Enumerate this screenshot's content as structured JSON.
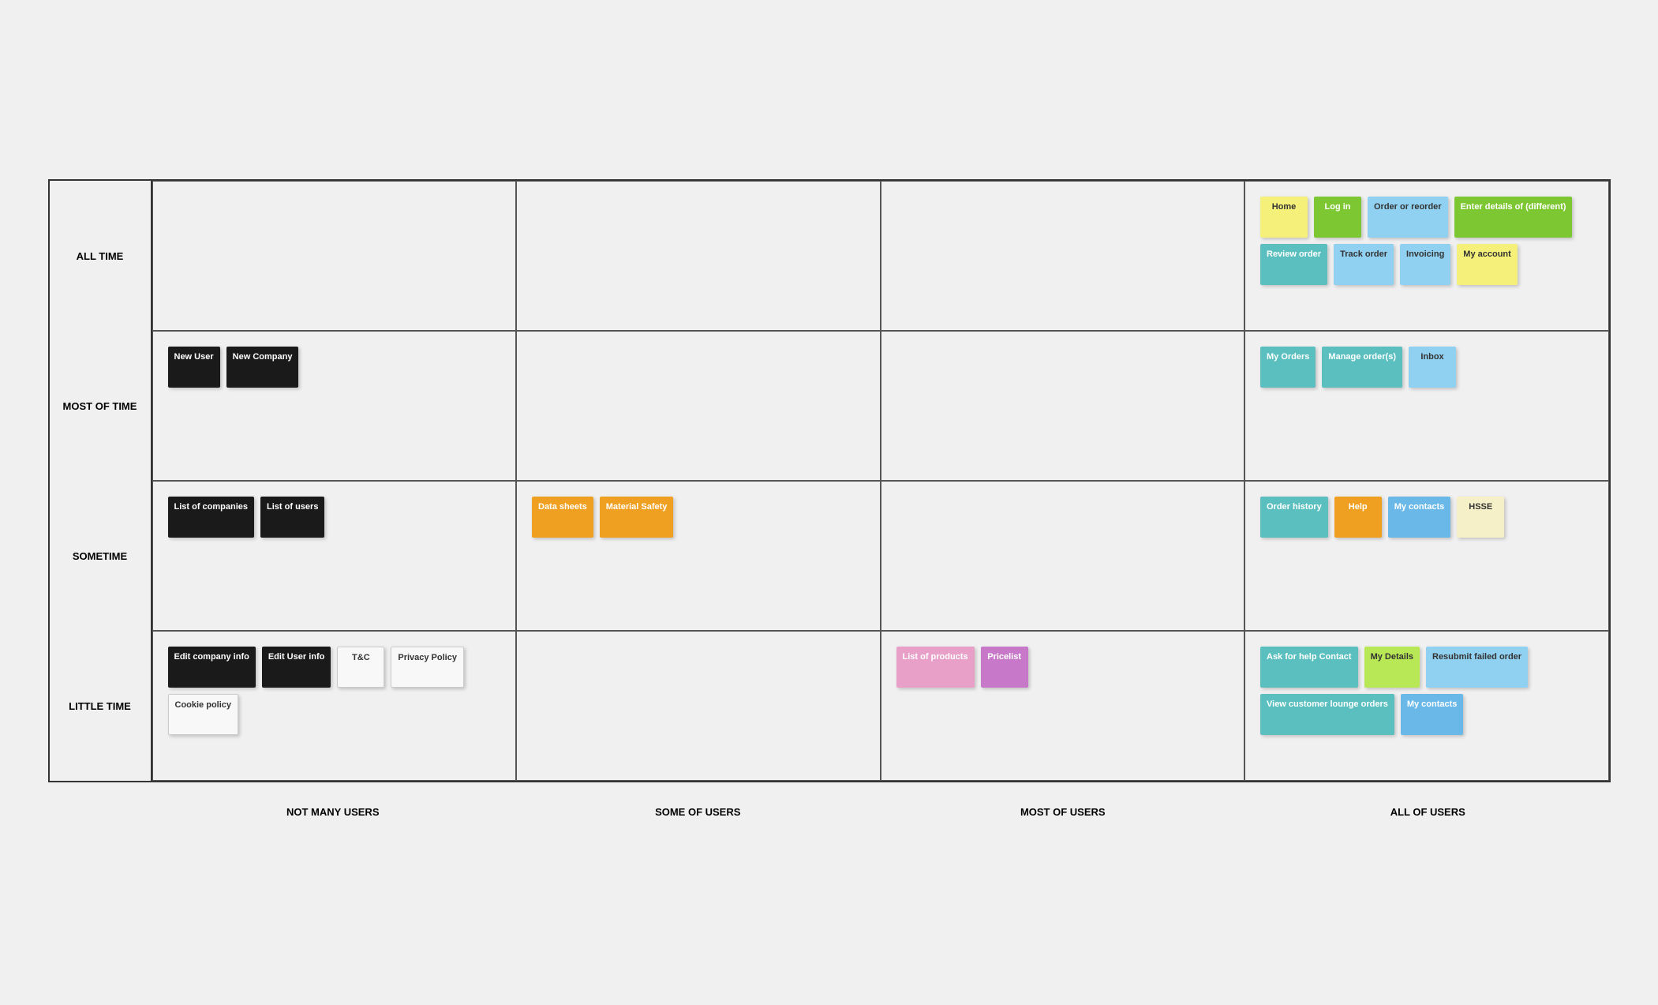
{
  "rowLabels": [
    "ALL TIME",
    "MOST OF TIME",
    "SOMETIME",
    "LITTLE TIME"
  ],
  "colLabels": [
    "NOT MANY USERS",
    "SOME OF USERS",
    "MOST OF USERS",
    "ALL OF USERS"
  ],
  "rows": [
    {
      "id": "alltime",
      "cells": [
        {
          "notes": []
        },
        {
          "notes": []
        },
        {
          "notes": []
        },
        {
          "notes": [
            {
              "text": "Home",
              "style": "yellow"
            },
            {
              "text": "Log in",
              "style": "green"
            },
            {
              "text": "Order or reorder",
              "style": "lightblue"
            },
            {
              "text": "Enter details of (different)",
              "style": "green"
            },
            {
              "text": "Review order",
              "style": "teal"
            },
            {
              "text": "Track order",
              "style": "lightblue"
            },
            {
              "text": "Invoicing",
              "style": "lightblue"
            },
            {
              "text": "My account",
              "style": "yellow"
            }
          ]
        }
      ]
    },
    {
      "id": "most",
      "cells": [
        {
          "notes": [
            {
              "text": "New User",
              "style": "black"
            },
            {
              "text": "New Company",
              "style": "black"
            }
          ]
        },
        {
          "notes": []
        },
        {
          "notes": []
        },
        {
          "notes": [
            {
              "text": "My Orders",
              "style": "teal"
            },
            {
              "text": "Manage order(s)",
              "style": "teal"
            },
            {
              "text": "Inbox",
              "style": "lightblue"
            }
          ]
        }
      ]
    },
    {
      "id": "sometime",
      "cells": [
        {
          "notes": [
            {
              "text": "List of companies",
              "style": "black"
            },
            {
              "text": "List of users",
              "style": "black"
            }
          ]
        },
        {
          "notes": [
            {
              "text": "Data sheets",
              "style": "orange"
            },
            {
              "text": "Material Safety",
              "style": "orange"
            }
          ]
        },
        {
          "notes": []
        },
        {
          "notes": [
            {
              "text": "Order history",
              "style": "teal"
            },
            {
              "text": "Help",
              "style": "orange"
            },
            {
              "text": "My contacts",
              "style": "blue"
            },
            {
              "text": "HSSE",
              "style": "cream"
            }
          ]
        }
      ]
    },
    {
      "id": "little",
      "cells": [
        {
          "notes": [
            {
              "text": "Edit company info",
              "style": "black"
            },
            {
              "text": "Edit User info",
              "style": "black"
            },
            {
              "text": "T&C",
              "style": "white"
            },
            {
              "text": "Privacy Policy",
              "style": "white"
            },
            {
              "text": "Cookie policy",
              "style": "white"
            }
          ]
        },
        {
          "notes": []
        },
        {
          "notes": [
            {
              "text": "List of products",
              "style": "pink"
            },
            {
              "text": "Pricelist",
              "style": "purple"
            }
          ]
        },
        {
          "notes": [
            {
              "text": "Ask for help Contact",
              "style": "teal"
            },
            {
              "text": "My Details",
              "style": "lime"
            },
            {
              "text": "Resubmit failed order",
              "style": "lightblue"
            },
            {
              "text": "View customer lounge orders",
              "style": "teal"
            },
            {
              "text": "My contacts",
              "style": "blue"
            }
          ]
        }
      ]
    }
  ],
  "bottomLabels": [
    "NOT MANY USERS",
    "SOME OF USERS",
    "MOST OF USERS",
    "ALL OF USERS"
  ]
}
